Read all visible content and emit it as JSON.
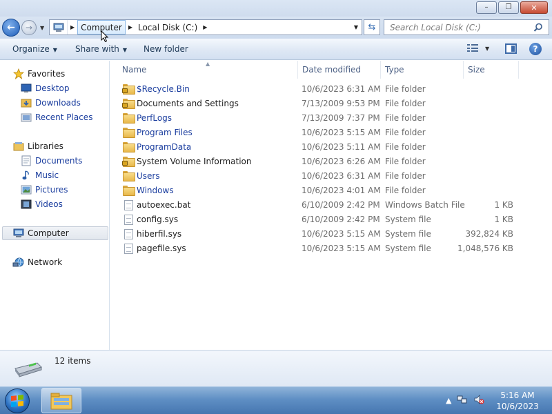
{
  "window": {
    "min_glyph": "–",
    "max_glyph": "❐",
    "close_glyph": "✕"
  },
  "address": {
    "crumbs": [
      "Computer",
      "Local Disk (C:)"
    ],
    "search_placeholder": "Search Local Disk (C:)"
  },
  "toolbar": {
    "organize": "Organize",
    "share_with": "Share with",
    "new_folder": "New folder"
  },
  "nav": {
    "favorites": "Favorites",
    "desktop": "Desktop",
    "downloads": "Downloads",
    "recent_places": "Recent Places",
    "libraries": "Libraries",
    "documents": "Documents",
    "music": "Music",
    "pictures": "Pictures",
    "videos": "Videos",
    "computer": "Computer",
    "network": "Network"
  },
  "columns": {
    "name": "Name",
    "date": "Date modified",
    "type": "Type",
    "size": "Size"
  },
  "files": [
    {
      "name": "$Recycle.Bin",
      "date": "10/6/2023 6:31 AM",
      "type": "File folder",
      "size": "",
      "icon": "locked-folder-icon"
    },
    {
      "name": "Documents and Settings",
      "date": "7/13/2009 9:53 PM",
      "type": "File folder",
      "size": "",
      "icon": "locked-folder-icon"
    },
    {
      "name": "PerfLogs",
      "date": "7/13/2009 7:37 PM",
      "type": "File folder",
      "size": "",
      "icon": "folder-icon"
    },
    {
      "name": "Program Files",
      "date": "10/6/2023 5:15 AM",
      "type": "File folder",
      "size": "",
      "icon": "folder-icon"
    },
    {
      "name": "ProgramData",
      "date": "10/6/2023 5:11 AM",
      "type": "File folder",
      "size": "",
      "icon": "folder-icon"
    },
    {
      "name": "System Volume Information",
      "date": "10/6/2023 6:26 AM",
      "type": "File folder",
      "size": "",
      "icon": "locked-folder-icon"
    },
    {
      "name": "Users",
      "date": "10/6/2023 6:31 AM",
      "type": "File folder",
      "size": "",
      "icon": "folder-icon"
    },
    {
      "name": "Windows",
      "date": "10/6/2023 4:01 AM",
      "type": "File folder",
      "size": "",
      "icon": "folder-icon"
    },
    {
      "name": "autoexec.bat",
      "date": "6/10/2009 2:42 PM",
      "type": "Windows Batch File",
      "size": "1 KB",
      "icon": "batch-file-icon"
    },
    {
      "name": "config.sys",
      "date": "6/10/2009 2:42 PM",
      "type": "System file",
      "size": "1 KB",
      "icon": "system-file-icon"
    },
    {
      "name": "hiberfil.sys",
      "date": "10/6/2023 5:15 AM",
      "type": "System file",
      "size": "392,824 KB",
      "icon": "system-file-icon"
    },
    {
      "name": "pagefile.sys",
      "date": "10/6/2023 5:15 AM",
      "type": "System file",
      "size": "1,048,576 KB",
      "icon": "system-file-icon"
    }
  ],
  "details": {
    "item_count": "12 items"
  },
  "taskbar": {
    "time": "5:16 AM",
    "date": "10/6/2023"
  },
  "colors": {
    "link_blue": "#1a3d9e",
    "header_text": "#4d6185",
    "taskbar_blue": "#5f8fc4"
  }
}
